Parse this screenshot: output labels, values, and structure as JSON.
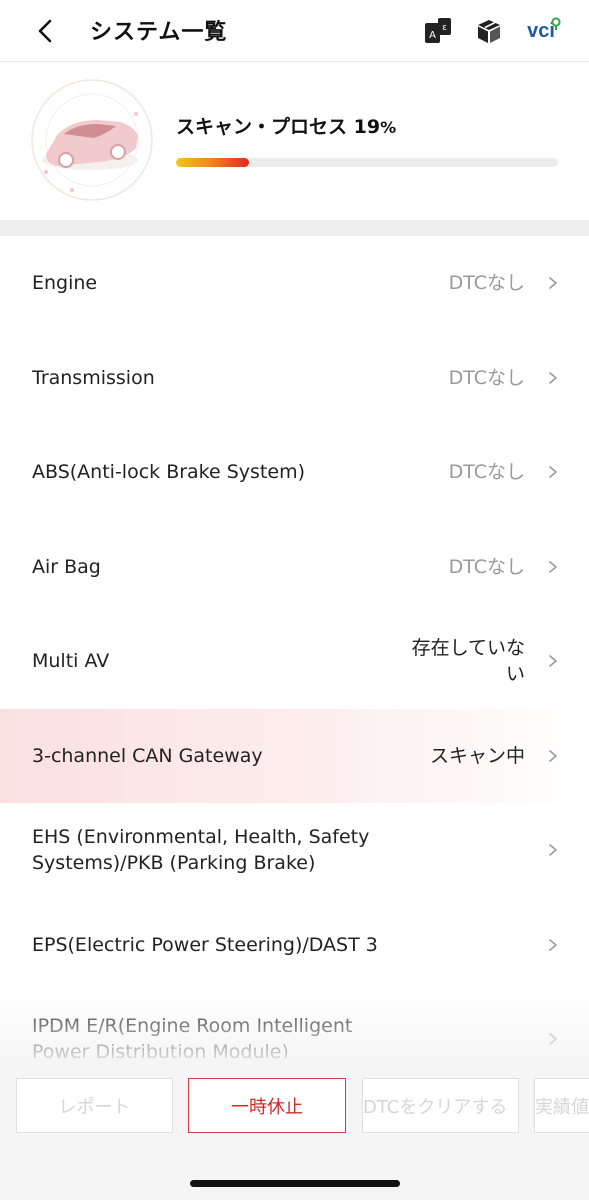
{
  "header": {
    "title": "システム一覧",
    "vci_label": "vci"
  },
  "scan": {
    "label": "スキャン・プロセス",
    "percent_text": "19",
    "percent_sign": "%",
    "progress": 0.19
  },
  "systems": [
    {
      "name": "Engine",
      "status": "DTCなし"
    },
    {
      "name": "Transmission",
      "status": "DTCなし"
    },
    {
      "name": "ABS(Anti-lock Brake System)",
      "status": "DTCなし"
    },
    {
      "name": "Air Bag",
      "status": "DTCなし"
    },
    {
      "name": "Multi AV",
      "status": "存在していない"
    },
    {
      "name": "3-channel CAN Gateway",
      "status": "スキャン中",
      "active": true
    },
    {
      "name": "EHS (Environmental, Health, Safety Systems)/PKB (Parking Brake)",
      "status": ""
    },
    {
      "name": "EPS(Electric Power Steering)/DAST 3",
      "status": ""
    },
    {
      "name": "IPDM E/R(Engine Room Intelligent Power Distribution Module)",
      "status": ""
    }
  ],
  "buttons": {
    "report": "レポート",
    "pause": "一時休止",
    "clear_dtc": "DTCをクリアする",
    "actual_values": "実績値"
  },
  "colors": {
    "accent_red": "#d02a2a",
    "progress_start": "#f5c518",
    "progress_end": "#e6271e",
    "vci_blue": "#1e5aa8",
    "vci_green": "#2fa84f"
  },
  "icons": {
    "back": "chevron-left-icon",
    "translate": "translate-icon",
    "box": "box-icon",
    "vci": "vci-connection-icon",
    "row_arrow": "chevron-right-icon",
    "car": "car-icon"
  }
}
